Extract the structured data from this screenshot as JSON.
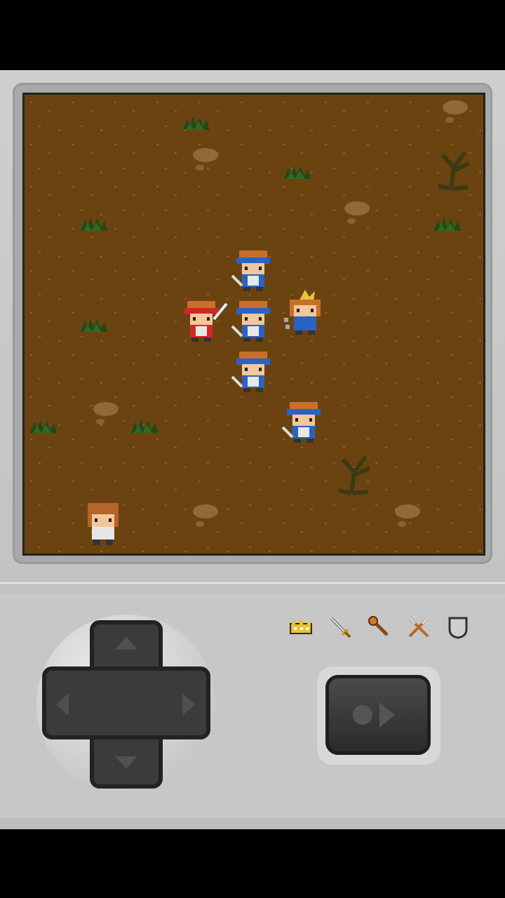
{
  "game": {
    "field_color": "#6b4310",
    "inventory": [
      {
        "icon": "crown-icon"
      },
      {
        "icon": "sword-icon"
      },
      {
        "icon": "club-icon"
      },
      {
        "icon": "crossed-weapons-icon"
      },
      {
        "icon": "shield-icon"
      }
    ],
    "units": [
      {
        "role": "soldier-blue",
        "count": 4
      },
      {
        "role": "warrior-red",
        "count": 1
      },
      {
        "role": "princess",
        "count": 1
      },
      {
        "role": "hero",
        "count": 1
      }
    ]
  }
}
